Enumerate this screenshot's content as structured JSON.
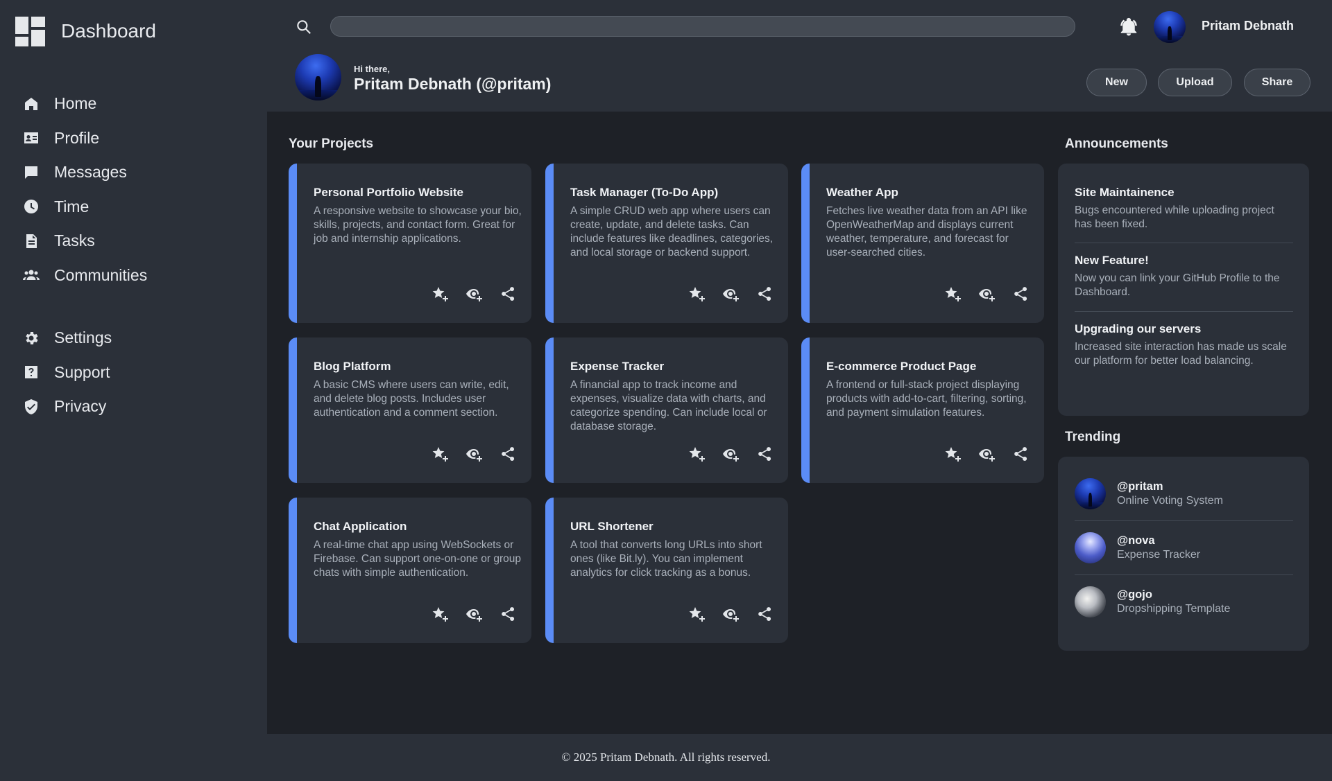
{
  "sidebar": {
    "brand": "Dashboard",
    "nav_primary": [
      {
        "label": "Home",
        "icon": "home-icon"
      },
      {
        "label": "Profile",
        "icon": "profile-card-icon"
      },
      {
        "label": "Messages",
        "icon": "chat-bubble-icon"
      },
      {
        "label": "Time",
        "icon": "clock-icon"
      },
      {
        "label": "Tasks",
        "icon": "document-icon"
      },
      {
        "label": "Communities",
        "icon": "group-icon"
      }
    ],
    "nav_secondary": [
      {
        "label": "Settings",
        "icon": "gear-icon"
      },
      {
        "label": "Support",
        "icon": "help-icon"
      },
      {
        "label": "Privacy",
        "icon": "shield-check-icon"
      }
    ]
  },
  "header": {
    "search": {
      "value": "",
      "placeholder": ""
    },
    "user_name": "Pritam Debnath",
    "greeting": "Hi there,",
    "display_name": "Pritam Debnath (@pritam)",
    "buttons": [
      "New",
      "Upload",
      "Share"
    ]
  },
  "projects": {
    "title": "Your Projects",
    "items": [
      {
        "title": "Personal Portfolio Website",
        "description": "A responsive website to showcase your bio, skills, projects, and contact form. Great for job and internship applications."
      },
      {
        "title": "Task Manager (To-Do App)",
        "description": "A simple CRUD web app where users can create, update, and delete tasks. Can include features like deadlines, categories, and local storage or backend support."
      },
      {
        "title": "Weather App",
        "description": "Fetches live weather data from an API like OpenWeatherMap and displays current weather, temperature, and forecast for user-searched cities."
      },
      {
        "title": "Blog Platform",
        "description": "A basic CMS where users can write, edit, and delete blog posts. Includes user authentication and a comment section."
      },
      {
        "title": "Expense Tracker",
        "description": "A financial app to track income and expenses, visualize data with charts, and categorize spending. Can include local or database storage."
      },
      {
        "title": "E-commerce Product Page",
        "description": "A frontend or full-stack project displaying products with add-to-cart, filtering, sorting, and payment simulation features."
      },
      {
        "title": "Chat Application",
        "description": "A real-time chat app using WebSockets or Firebase. Can support one-on-one or group chats with simple authentication."
      },
      {
        "title": "URL Shortener",
        "description": "A tool that converts long URLs into short ones (like Bit.ly). You can implement analytics for click tracking as a bonus."
      }
    ],
    "action_icons": [
      "star-plus-icon",
      "watch-eye-icon",
      "share-icon"
    ]
  },
  "announcements": {
    "title": "Announcements",
    "items": [
      {
        "title": "Site Maintainence",
        "body": "Bugs encountered while uploading project has been fixed."
      },
      {
        "title": "New Feature!",
        "body": "Now you can link your GitHub Profile to the Dashboard."
      },
      {
        "title": "Upgrading our servers",
        "body": "Increased site interaction has made us scale our platform for better load balancing."
      }
    ]
  },
  "trending": {
    "title": "Trending",
    "items": [
      {
        "handle": "@pritam",
        "project": "Online Voting System"
      },
      {
        "handle": "@nova",
        "project": "Expense Tracker"
      },
      {
        "handle": "@gojo",
        "project": "Dropshipping Template"
      }
    ]
  },
  "footer": {
    "text": "© 2025 Pritam Debnath. All rights reserved."
  },
  "colors": {
    "accent": "#5b8cf6",
    "panel": "#2b3039",
    "background": "#1e2127"
  }
}
